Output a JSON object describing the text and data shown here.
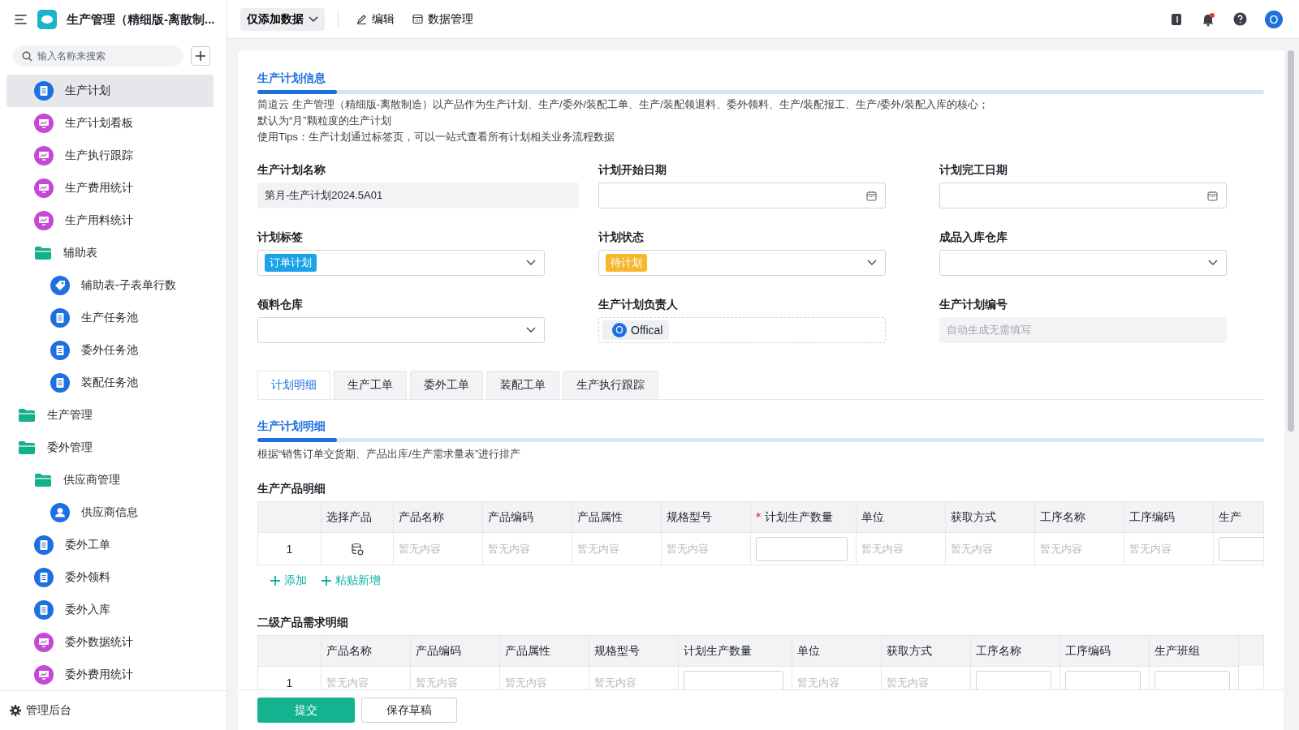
{
  "header": {
    "app_title": "生产管理（精细版-离散制...",
    "mode_button": "仅添加数据",
    "actions": [
      {
        "kind": "edit",
        "label": "编辑"
      },
      {
        "kind": "data",
        "label": "数据管理"
      }
    ],
    "notification_dot": true,
    "avatar": "O"
  },
  "sidebar": {
    "search": {
      "placeholder": "输入名称来搜索"
    },
    "continued_items": [
      {
        "label": "生产计划",
        "kind": "doc",
        "selected": true
      },
      {
        "label": "生产计划看板",
        "kind": "dashboard",
        "selected": false
      },
      {
        "label": "生产执行跟踪",
        "kind": "dashboard",
        "selected": false
      },
      {
        "label": "生产费用统计",
        "kind": "dashboard",
        "selected": false
      },
      {
        "label": "生产用料统计",
        "kind": "dashboard",
        "selected": false
      },
      {
        "label": "辅助表",
        "kind": "folder",
        "selected": false,
        "children": [
          {
            "label": "辅助表-子表单行数",
            "kind": "tag",
            "selected": false
          },
          {
            "label": "生产任务池",
            "kind": "doc",
            "selected": false
          },
          {
            "label": "委外任务池",
            "kind": "doc",
            "selected": false
          },
          {
            "label": "装配任务池",
            "kind": "doc",
            "selected": false
          }
        ]
      }
    ],
    "items": [
      {
        "label": "生产管理",
        "kind": "folder",
        "selected": false
      },
      {
        "label": "委外管理",
        "kind": "folder",
        "selected": false,
        "children": [
          {
            "label": "供应商管理",
            "kind": "folder",
            "selected": false,
            "children": [
              {
                "label": "供应商信息",
                "kind": "user",
                "selected": false
              }
            ]
          },
          {
            "label": "委外工单",
            "kind": "doc",
            "selected": false
          },
          {
            "label": "委外领料",
            "kind": "doc",
            "selected": false
          },
          {
            "label": "委外入库",
            "kind": "doc",
            "selected": false
          },
          {
            "label": "委外数据统计",
            "kind": "dashboard",
            "selected": false
          },
          {
            "label": "委外费用统计",
            "kind": "dashboard",
            "selected": false
          }
        ]
      }
    ],
    "footer": "管理后台"
  },
  "form": {
    "section_title": "生产计划信息",
    "description": [
      "简道云 生产管理（精细版-离散制造）以产品作为生产计划、生产/委外/装配工单、生产/装配领退料、委外领料、生产/装配报工、生产/委外/装配入库的核心；",
      "默认为“月”颗粒度的生产计划",
      "使用Tips：生产计划通过标签页，可以一站式查看所有计划相关业务流程数据"
    ],
    "fields": [
      {
        "label": "生产计划名称",
        "kind": "text",
        "value": "第月-生产计划2024.5A01"
      },
      {
        "label": "计划开始日期",
        "kind": "date"
      },
      {
        "label": "计划完工日期",
        "kind": "date"
      },
      {
        "label": "计划标签",
        "kind": "select",
        "tag": "订单计划",
        "color": "#1aa3e8"
      },
      {
        "label": "计划状态",
        "kind": "select",
        "tag": "待计划",
        "color": "#f5b82e"
      },
      {
        "label": "成品入库仓库",
        "kind": "select"
      },
      {
        "label": "领料仓库",
        "kind": "select"
      },
      {
        "label": "生产计划负责人",
        "kind": "member",
        "initial": "O",
        "value": "Offical"
      },
      {
        "label": "生产计划编号",
        "kind": "readonly",
        "placeholder": "自动生成无需填写"
      }
    ]
  },
  "tabs": [
    {
      "label": "计划明细",
      "selected": true
    },
    {
      "label": "生产工单",
      "selected": false
    },
    {
      "label": "委外工单",
      "selected": false
    },
    {
      "label": "装配工单",
      "selected": false
    },
    {
      "label": "生产执行跟踪",
      "selected": false
    }
  ],
  "detail": {
    "section_title": "生产计划明细",
    "description": "根据“销售订单交货期、产品出库/生产需求量表”进行排产",
    "tables": [
      {
        "title": "生产产品明细",
        "columns": [
          {
            "label": "选择产品",
            "required": false
          },
          {
            "label": "产品名称",
            "required": false
          },
          {
            "label": "产品编码",
            "required": false
          },
          {
            "label": "产品属性",
            "required": false
          },
          {
            "label": "规格型号",
            "required": false
          },
          {
            "label": "计划生产数量",
            "required": true
          },
          {
            "label": "单位",
            "required": false
          },
          {
            "label": "获取方式",
            "required": false
          },
          {
            "label": "工序名称",
            "required": false
          },
          {
            "label": "工序编码",
            "required": false
          },
          {
            "label": "生产",
            "required": false
          }
        ],
        "rows": [
          {
            "index": "1",
            "cells": [
              {
                "kind": "picker"
              },
              {
                "kind": "empty",
                "text": "暂无内容"
              },
              {
                "kind": "empty",
                "text": "暂无内容"
              },
              {
                "kind": "empty",
                "text": "暂无内容"
              },
              {
                "kind": "empty",
                "text": "暂无内容"
              },
              {
                "kind": "input"
              },
              {
                "kind": "empty",
                "text": "暂无内容"
              },
              {
                "kind": "empty",
                "text": "暂无内容"
              },
              {
                "kind": "empty",
                "text": "暂无内容"
              },
              {
                "kind": "empty",
                "text": "暂无内容"
              },
              {
                "kind": "input"
              }
            ]
          }
        ],
        "actions": [
          "添加",
          "粘贴新增"
        ]
      },
      {
        "title": "二级产品需求明细",
        "columns": [
          {
            "label": "产品名称",
            "required": false
          },
          {
            "label": "产品编码",
            "required": false
          },
          {
            "label": "产品属性",
            "required": false
          },
          {
            "label": "规格型号",
            "required": false
          },
          {
            "label": "计划生产数量",
            "required": false
          },
          {
            "label": "单位",
            "required": false
          },
          {
            "label": "获取方式",
            "required": false
          },
          {
            "label": "工序名称",
            "required": false
          },
          {
            "label": "工序编码",
            "required": false
          },
          {
            "label": "生产班组",
            "required": false
          }
        ],
        "rows": [
          {
            "index": "1",
            "cells": [
              {
                "kind": "empty",
                "text": "暂无内容"
              },
              {
                "kind": "empty",
                "text": "暂无内容"
              },
              {
                "kind": "empty",
                "text": "暂无内容"
              },
              {
                "kind": "empty",
                "text": "暂无内容"
              },
              {
                "kind": "input"
              },
              {
                "kind": "empty",
                "text": "暂无内容"
              },
              {
                "kind": "empty",
                "text": "暂无内容"
              },
              {
                "kind": "input"
              },
              {
                "kind": "input"
              },
              {
                "kind": "input"
              }
            ]
          }
        ]
      }
    ]
  },
  "footer_buttons": [
    {
      "label": "提交",
      "kind": "primary"
    },
    {
      "label": "保存草稿",
      "kind": "secondary"
    }
  ]
}
